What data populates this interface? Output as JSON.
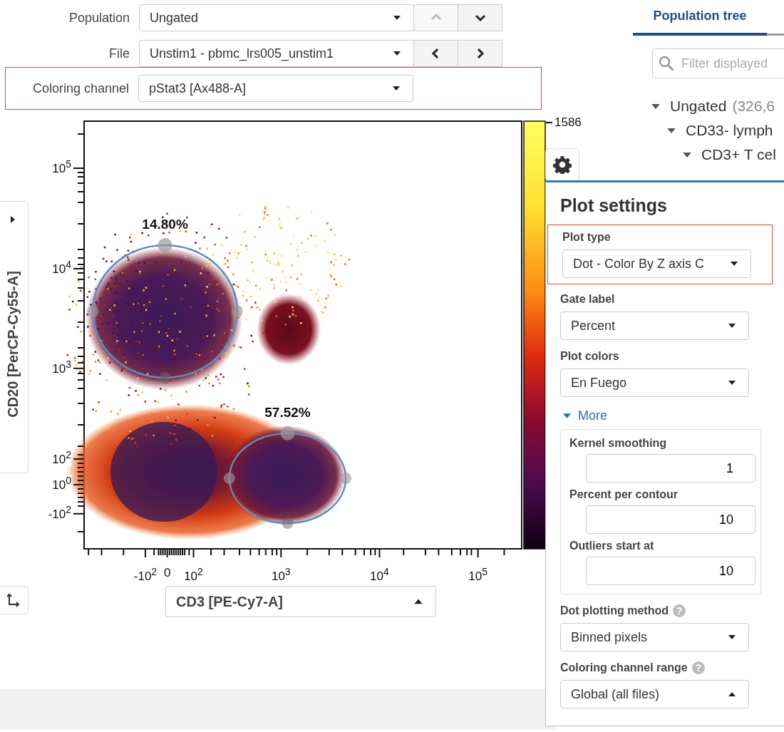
{
  "controls": [
    {
      "label": "Population",
      "value": "Ungated",
      "highlighted": false,
      "nav": [
        {
          "kind": "up",
          "disabled": true
        },
        {
          "kind": "down",
          "disabled": false
        }
      ]
    },
    {
      "label": "File",
      "value": "Unstim1 - pbmc_lrs005_unstim1",
      "highlighted": false,
      "nav": [
        {
          "kind": "left",
          "disabled": false
        },
        {
          "kind": "right",
          "disabled": false
        }
      ]
    },
    {
      "label": "Coloring channel",
      "value": "pStat3 [Ax488-A]",
      "highlighted": true
    }
  ],
  "plot": {
    "y_axis": "CD20 [PerCP-Cy55-A]",
    "x_axis": {
      "value": "CD3 [PE-Cy7-A]",
      "open": true
    },
    "y_ticks": [
      "10$^{5}$",
      "10$^{4}$",
      "10$^{3}$",
      "10$^{2}$",
      "10$^{0}$",
      "-10$^{2}$"
    ],
    "x_ticks": [
      "-10$^{2}$",
      "0",
      "10$^{2}$",
      "10$^{3}$",
      "10$^{4}$",
      "10$^{5}$"
    ],
    "gates": [
      {
        "label": "14.80%"
      },
      {
        "label": "57.52%"
      }
    ],
    "scale_max": "1586"
  },
  "tree": {
    "tab": "Population tree",
    "filter_placeholder": "Filter displayed",
    "items": [
      {
        "name": "Ungated",
        "count": "(326,6",
        "expanded": true,
        "children": [
          {
            "name": "CD33- lymph",
            "expanded": true,
            "children": [
              {
                "name": "CD3+ T cel",
                "expanded": true
              }
            ]
          }
        ]
      }
    ]
  },
  "settings": {
    "title": "Plot settings",
    "fields": [
      {
        "label": "Plot type",
        "value": "Dot - Color By Z axis C",
        "highlighted": true,
        "open": false
      },
      {
        "label": "Gate label",
        "value": "Percent",
        "highlighted": false,
        "open": false
      },
      {
        "label": "Plot colors",
        "value": "En Fuego",
        "highlighted": false,
        "open": false
      }
    ],
    "more": {
      "label": "More",
      "expanded": true,
      "inputs": [
        {
          "label": "Kernel smoothing",
          "value": "1"
        },
        {
          "label": "Percent per contour",
          "value": "10"
        },
        {
          "label": "Outliers start at",
          "value": "10"
        }
      ]
    },
    "extra": [
      {
        "label": "Dot plotting method",
        "help": "?",
        "value": "Binned pixels",
        "open": false
      },
      {
        "label": "Coloring channel range",
        "help": "?",
        "value": "Global (all files)",
        "open": true
      }
    ]
  }
}
